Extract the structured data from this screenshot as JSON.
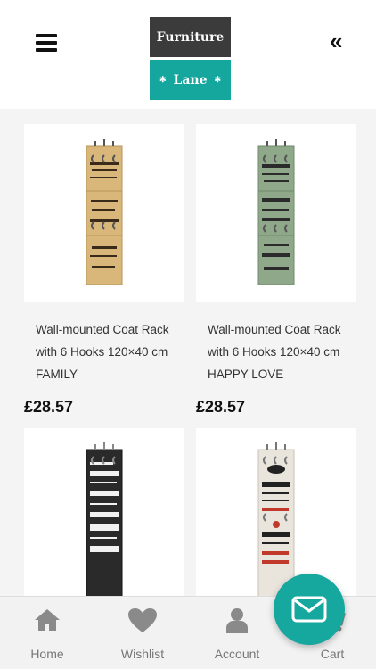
{
  "header": {
    "logo_top": "Furniture",
    "logo_bottom": "Lane",
    "menu_icon": "hamburger-icon",
    "collapse_icon": "double-chevron-left-icon"
  },
  "products": [
    {
      "title": "Wall-mounted Coat Rack with 6 Hooks 120×40 cm FAMILY",
      "price": "£28.57",
      "rack_color": "#d9b77a",
      "text_color": "#3a2a1a"
    },
    {
      "title": "Wall-mounted Coat Rack with 6 Hooks 120×40 cm HAPPY LOVE",
      "price": "£28.57",
      "rack_color": "#8fa889",
      "text_color": "#2b2b2b"
    },
    {
      "title": "",
      "price": "",
      "rack_color": "#2a2a2a",
      "text_color": "#f1f1f1"
    },
    {
      "title": "",
      "price": "",
      "rack_color": "#e9e4dc",
      "text_color": "#222222"
    }
  ],
  "nav": {
    "home": "Home",
    "wishlist": "Wishlist",
    "account": "Account",
    "cart": "Cart"
  },
  "colors": {
    "accent": "#16a79e",
    "logo_dark": "#3b3b3b"
  },
  "fab_icon": "mail-icon"
}
